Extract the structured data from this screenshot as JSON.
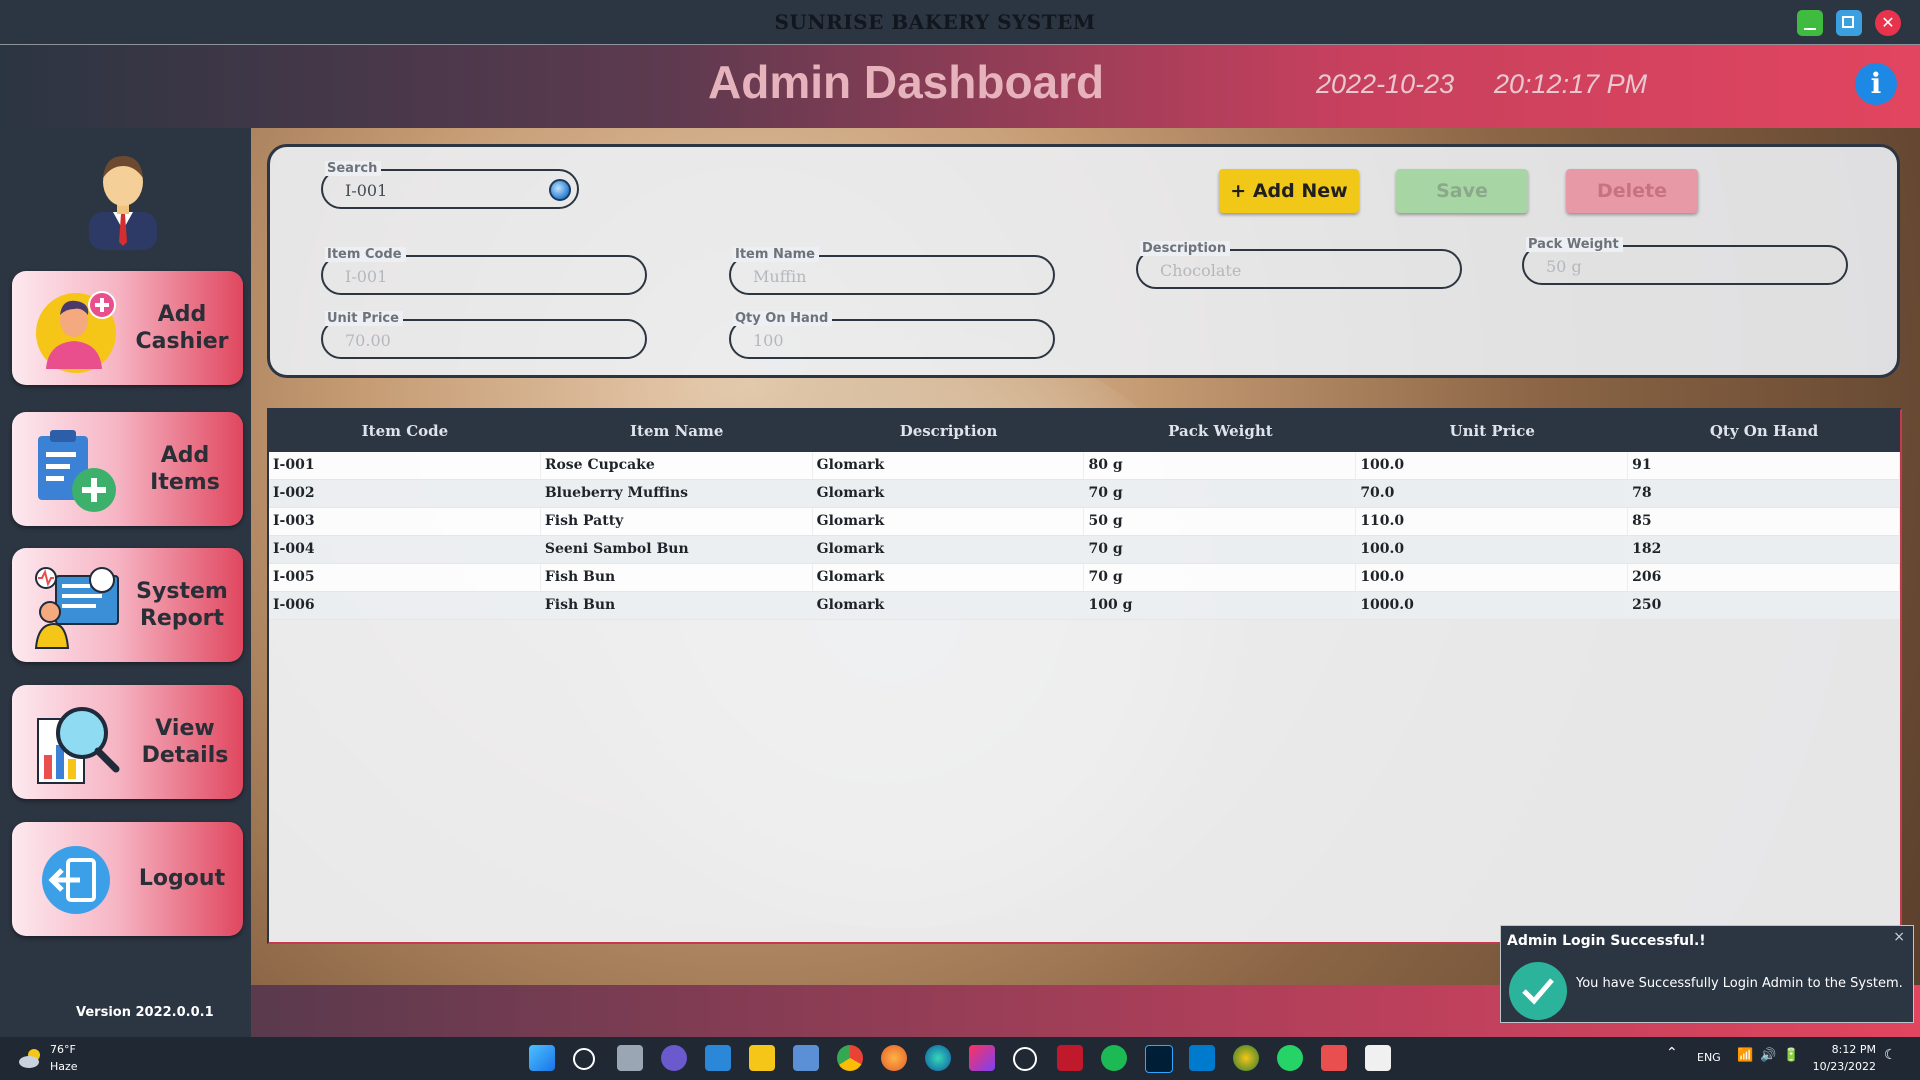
{
  "window": {
    "title": "SUNRISE BAKERY SYSTEM"
  },
  "header": {
    "title": "Admin Dashboard",
    "date": "2022-10-23",
    "time": "20:12:17 PM",
    "info_icon": "i"
  },
  "sidebar": {
    "items": [
      {
        "label": "Add\nCashier",
        "icon": "add-cashier-icon"
      },
      {
        "label": "Add\nItems",
        "icon": "add-items-icon"
      },
      {
        "label": "System\nReport",
        "icon": "system-report-icon"
      },
      {
        "label": "View\nDetails",
        "icon": "view-details-icon"
      },
      {
        "label": "Logout",
        "icon": "logout-icon"
      }
    ],
    "version": "Version 2022.0.0.1"
  },
  "form": {
    "search": {
      "label": "Search",
      "value": "I-001"
    },
    "item_code": {
      "label": "Item Code",
      "value": "I-001"
    },
    "item_name": {
      "label": "Item Name",
      "value": "Muffin"
    },
    "description": {
      "label": "Description",
      "value": "Chocolate"
    },
    "pack_weight": {
      "label": "Pack Weight",
      "value": "50 g"
    },
    "unit_price": {
      "label": "Unit Price",
      "value": "70.00"
    },
    "qty_on_hand": {
      "label": "Qty On Hand",
      "value": "100"
    },
    "buttons": {
      "add": "+ Add New",
      "save": "Save",
      "delete": "Delete"
    }
  },
  "table": {
    "columns": [
      "Item Code",
      "Item Name",
      "Description",
      "Pack Weight",
      "Unit Price",
      "Qty On Hand"
    ],
    "rows": [
      [
        "I-001",
        "Rose Cupcake",
        "Glomark",
        "80 g",
        "100.0",
        "91"
      ],
      [
        "I-002",
        "Blueberry Muffins",
        "Glomark",
        "70 g",
        "70.0",
        "78"
      ],
      [
        "I-003",
        "Fish Patty",
        "Glomark",
        "50 g",
        "110.0",
        "85"
      ],
      [
        "I-004",
        "Seeni Sambol Bun",
        "Glomark",
        "70 g",
        "100.0",
        "182"
      ],
      [
        "I-005",
        "Fish Bun",
        "Glomark",
        "70 g",
        "100.0",
        "206"
      ],
      [
        "I-006",
        "Fish Bun",
        "Glomark",
        "100 g",
        "1000.0",
        "250"
      ]
    ]
  },
  "toast": {
    "title": "Admin Login Successful.!",
    "message": "You have Successfully Login Admin to the System.",
    "close": "×"
  },
  "taskbar": {
    "weather_temp": "76°F",
    "weather_cond": "Haze",
    "lang": "ENG",
    "clock_time": "8:12 PM",
    "clock_date": "10/23/2022"
  },
  "colors": {
    "accent": "#e2455f",
    "dark": "#2c3542",
    "add": "#f2c818",
    "save": "#a7d6a4",
    "delete": "#e79aa6"
  }
}
